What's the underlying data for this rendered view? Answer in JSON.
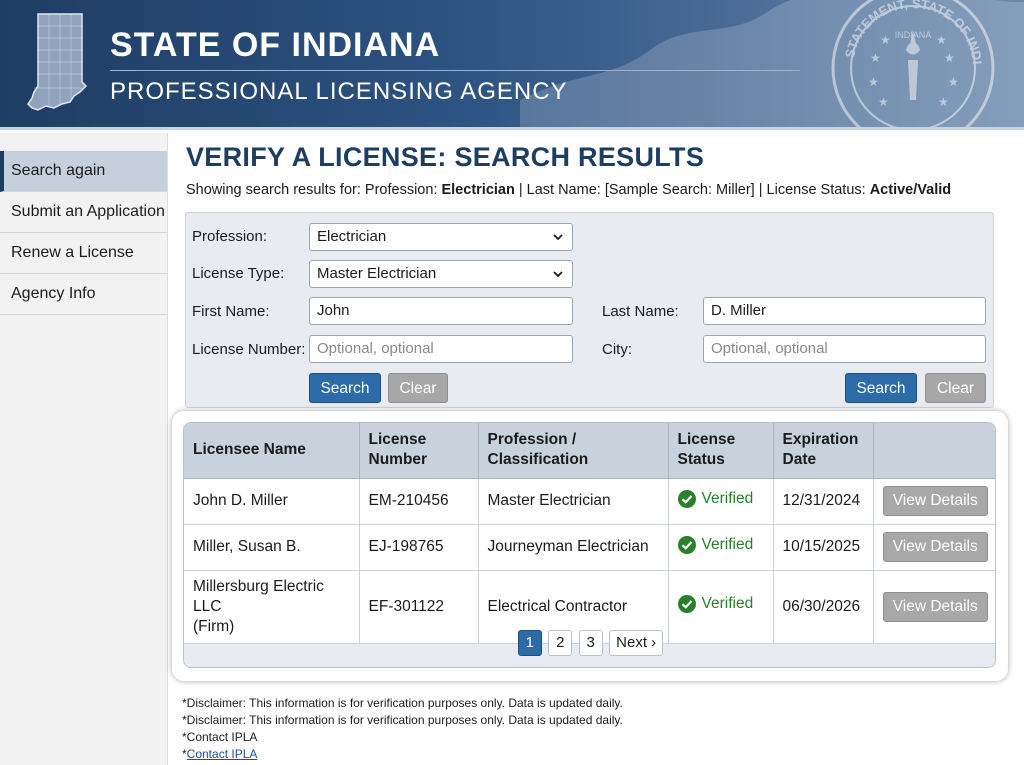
{
  "header": {
    "title": "STATE OF INDIANA",
    "subtitle": "PROFESSIONAL LICENSING AGENCY",
    "seal_text": "STATEMENT, STATE OF INDIANA",
    "seal_inner": "INDIANA"
  },
  "sidebar": {
    "items": [
      {
        "label": "Search again",
        "active": true
      },
      {
        "label": "Submit an Application"
      },
      {
        "label": "Renew a License"
      },
      {
        "label": "Agency Info"
      }
    ]
  },
  "page": {
    "title": "VERIFY A LICENSE: SEARCH RESULTS",
    "subtitle_prefix": "Showing search results for: Profession: ",
    "subtitle_profession": "Electrician",
    "subtitle_mid": " | Last Name: [Sample Search: Miller] | License Status: ",
    "subtitle_status": "Active/Valid"
  },
  "search": {
    "profession_label": "Profession:",
    "profession_value": "Electrician",
    "license_type_label": "License Type:",
    "license_type_value": "Master Electrician",
    "first_name_label": "First Name:",
    "first_name_value": "John",
    "last_name_label": "Last Name:",
    "last_name_value": "D. Miller",
    "license_number_label": "License Number:",
    "license_number_placeholder": "Optional, optional",
    "city_label": "City:",
    "city_placeholder": "Optional, optional",
    "search_label": "Search",
    "clear_label": "Clear"
  },
  "results": {
    "headers": {
      "name": "Licensee Name",
      "number_1": "License",
      "number_2": "Number",
      "profession_1": "Profession /",
      "profession_2": "Classification",
      "status_1": "License",
      "status_2": "Status",
      "expiration_1": "Expiration",
      "expiration_2": "Date"
    },
    "rows": [
      {
        "name": "John D. Miller",
        "number": "EM-210456",
        "profession": "Master Electrician",
        "status": "Verified",
        "expiration": "12/31/2024",
        "action": "View Details"
      },
      {
        "name": "Miller, Susan B.",
        "number": "EJ-198765",
        "profession": "Journeyman Electrician",
        "status": "Verified",
        "expiration": "10/15/2025",
        "action": "View Details"
      },
      {
        "name": "Millersburg Electric LLC",
        "name_2": "(Firm)",
        "number": "EF-301122",
        "profession": "Electrical Contractor",
        "status": "Verified",
        "expiration": "06/30/2026",
        "action": "View Details"
      }
    ],
    "pagination": {
      "pages": [
        "1",
        "2",
        "3"
      ],
      "current": "1",
      "next_label": "Next ›"
    }
  },
  "footer": {
    "disclaimer_1": "*Disclaimer: This information is for verification purposes only. Data is updated daily.",
    "disclaimer_2": "*Disclaimer: This information is for verification purposes only. Data is updated daily.",
    "contact_1": "*Contact IPLA",
    "contact_2_prefix": "*",
    "contact_2_link": "Contact IPLA"
  },
  "colors": {
    "header_dark": "#1e3d63",
    "primary_button": "#2d6aa8",
    "verified_green": "#2a7f2a",
    "disabled_button": "#a8a8a8"
  },
  "icons": [
    "indiana-state-outline-icon",
    "state-seal-icon",
    "chevron-down-icon",
    "check-circle-icon"
  ]
}
